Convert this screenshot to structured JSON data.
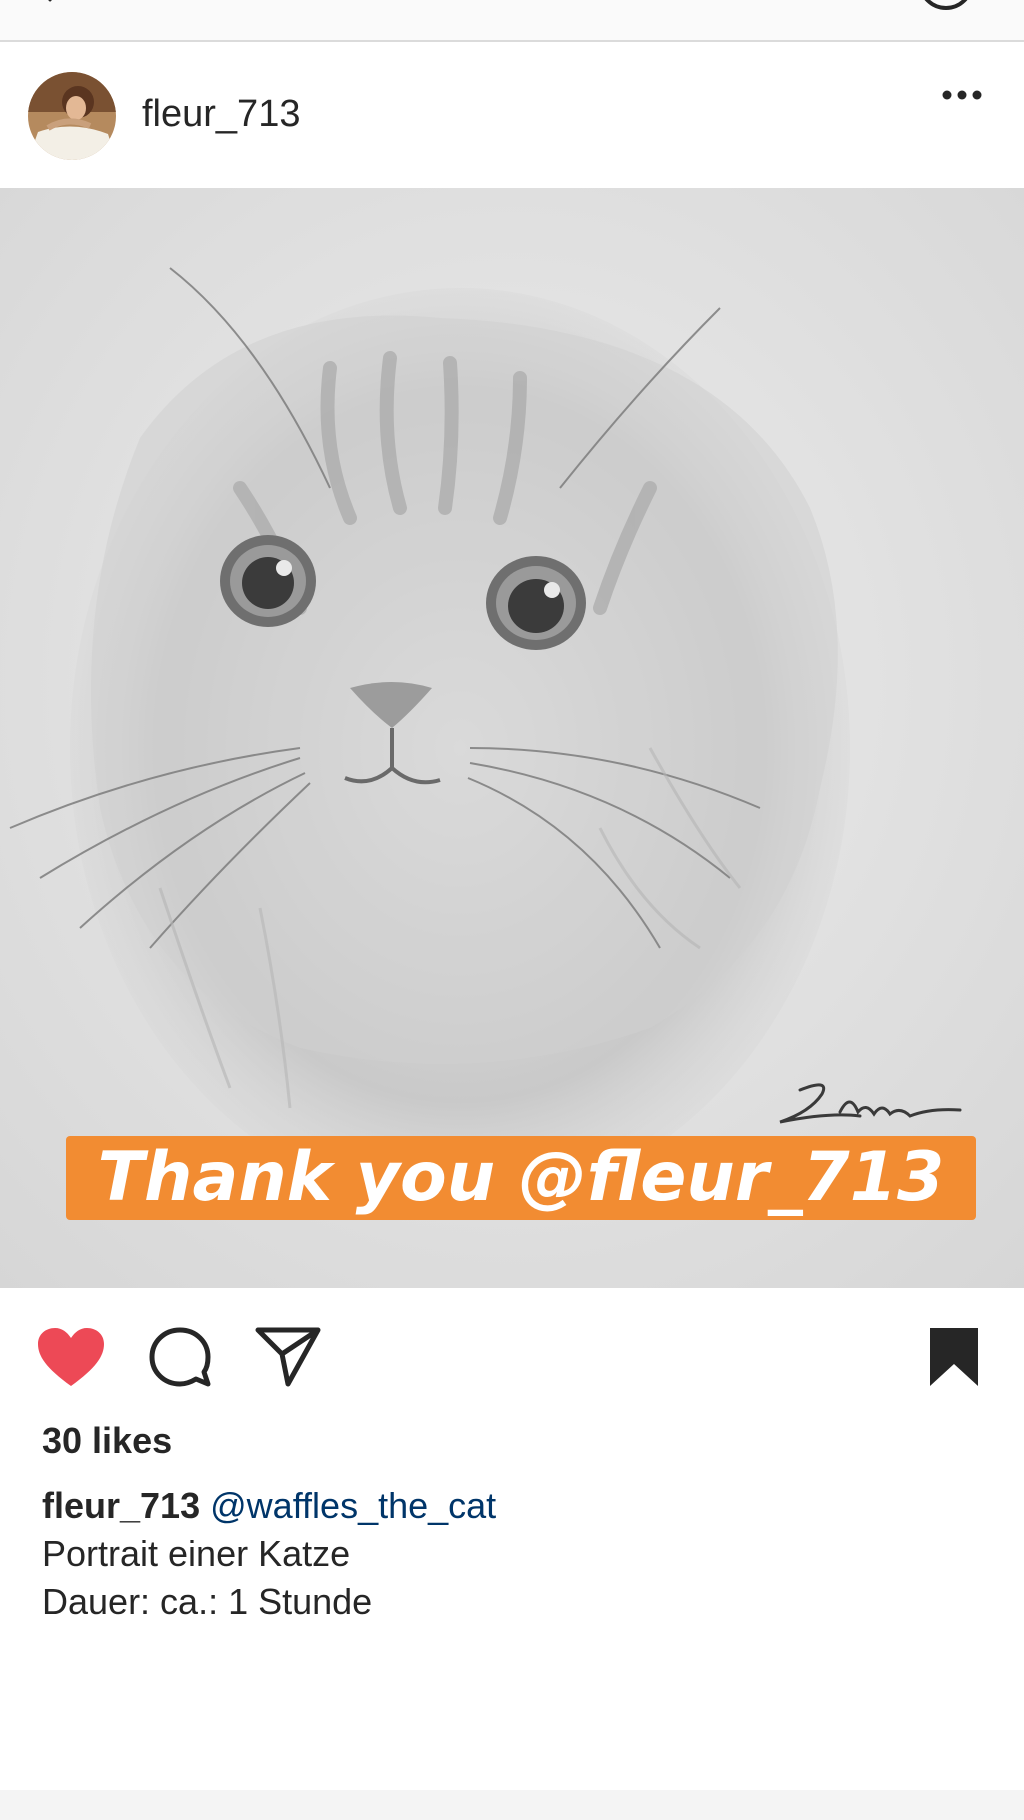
{
  "post": {
    "username": "fleur_713",
    "more_label": "...",
    "photo": {
      "sticker_text": "Thank you @fleur_713",
      "sticker_color": "#f28c32"
    }
  },
  "actions": {
    "like": "heart-icon",
    "comment": "comment-icon",
    "share": "paper-plane-icon",
    "save": "bookmark-icon",
    "like_color": "#ed4956"
  },
  "likes_text": "30 likes",
  "caption": {
    "username": "fleur_713",
    "mention": "@waffles_the_cat",
    "line2": "Portrait einer Katze",
    "line3": "Dauer: ca.: 1 Stunde"
  }
}
